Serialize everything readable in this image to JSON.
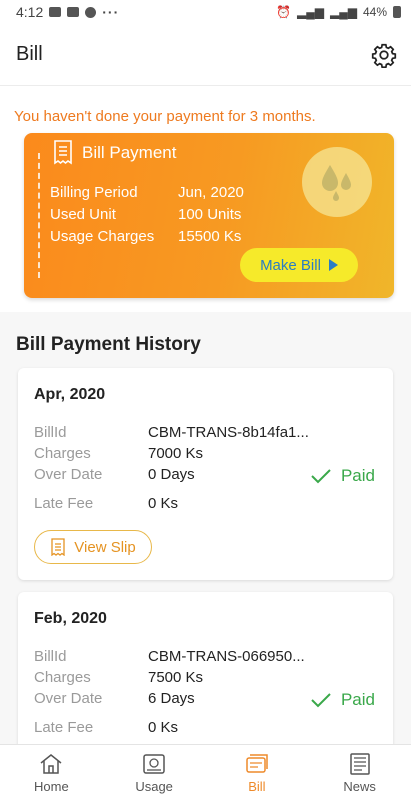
{
  "status_bar": {
    "time": "4:12",
    "dots": "···",
    "battery": "44%"
  },
  "app_bar": {
    "title": "Bill",
    "settings_icon": "gear-icon"
  },
  "warning": "You haven't done your payment for 3 months.",
  "bill_card": {
    "title": "Bill Payment",
    "rows": [
      {
        "label": "Billing Period",
        "value": "Jun, 2020"
      },
      {
        "label": "Used Unit",
        "value": "100 Units"
      },
      {
        "label": "Usage Charges",
        "value": "15500 Ks"
      }
    ],
    "button": "Make Bill"
  },
  "history": {
    "title": "Bill Payment History",
    "labels": {
      "bill_id": "BillId",
      "charges": "Charges",
      "over_date": "Over Date",
      "late_fee": "Late Fee"
    },
    "items": [
      {
        "month": "Apr, 2020",
        "bill_id": "CBM-TRANS-8b14fa1...",
        "charges": "7000 Ks",
        "over_date": "0 Days",
        "late_fee": "0 Ks",
        "status": "Paid",
        "slip": "View Slip"
      },
      {
        "month": "Feb, 2020",
        "bill_id": "CBM-TRANS-066950...",
        "charges": "7500 Ks",
        "over_date": "6 Days",
        "late_fee": "0 Ks",
        "status": "Paid"
      }
    ]
  },
  "nav": [
    {
      "label": "Home",
      "icon": "home-icon"
    },
    {
      "label": "Usage",
      "icon": "meter-icon"
    },
    {
      "label": "Bill",
      "icon": "bill-icon",
      "active": true
    },
    {
      "label": "News",
      "icon": "newspaper-icon"
    }
  ],
  "colors": {
    "accent": "#ee7a1f",
    "paid": "#3aa84a",
    "make_bill_bg": "#f6ea2a",
    "make_bill_text": "#2a7dc4"
  }
}
